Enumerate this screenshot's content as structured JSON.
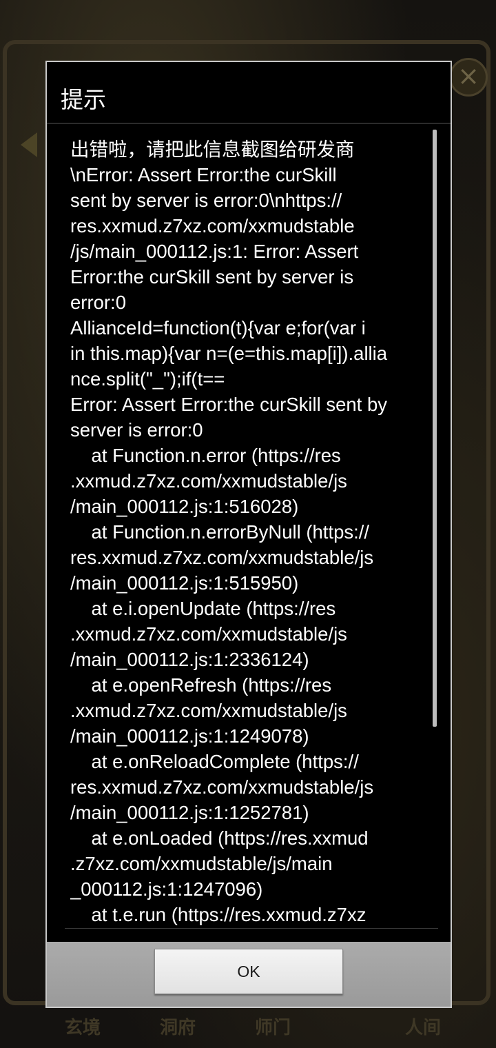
{
  "background": {
    "nav_items": [
      "玄境",
      "洞府",
      "师门",
      "人间"
    ]
  },
  "dialog": {
    "title": "提示",
    "message_lines": [
      "出错啦，请把此信息截图给研发商",
      "\\nError: Assert Error:the curSkill",
      "sent by server is error:0\\nhttps://",
      "res.xxmud.z7xz.com/xxmudstable",
      "/js/main_000112.js:1: Error: Assert",
      "Error:the curSkill sent by server is",
      "error:0",
      "AllianceId=function(t){var e;for(var i",
      "in this.map){var n=(e=this.map[i]).allia",
      "nce.split(\"_\");if(t==",
      "Error: Assert Error:the curSkill sent by",
      "server is error:0",
      "    at Function.n.error (https://res",
      ".xxmud.z7xz.com/xxmudstable/js",
      "/main_000112.js:1:516028)",
      "    at Function.n.errorByNull (https://",
      "res.xxmud.z7xz.com/xxmudstable/js",
      "/main_000112.js:1:515950)",
      "    at e.i.openUpdate (https://res",
      ".xxmud.z7xz.com/xxmudstable/js",
      "/main_000112.js:1:2336124)",
      "    at e.openRefresh (https://res",
      ".xxmud.z7xz.com/xxmudstable/js",
      "/main_000112.js:1:1249078)",
      "    at e.onReloadComplete (https://",
      "res.xxmud.z7xz.com/xxmudstable/js",
      "/main_000112.js:1:1252781)",
      "    at e.onLoaded (https://res.xxmud",
      ".z7xz.com/xxmudstable/js/main",
      "_000112.js:1:1247096)",
      "    at t.e.run (https://res.xxmud.z7xz"
    ],
    "ok_label": "OK"
  }
}
